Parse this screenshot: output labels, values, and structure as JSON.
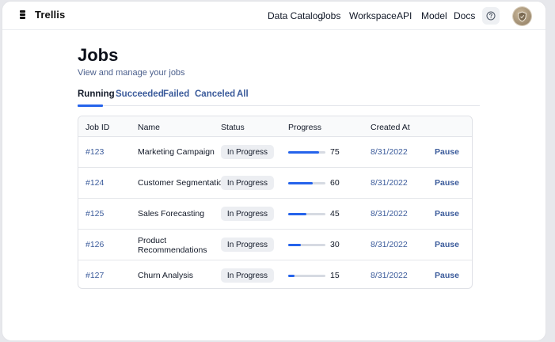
{
  "app": {
    "name": "Trellis"
  },
  "nav": [
    {
      "label": "Data Catalog"
    },
    {
      "label": "Jobs"
    },
    {
      "label": "Workspace"
    },
    {
      "label": "API"
    },
    {
      "label": "Model"
    },
    {
      "label": "Docs"
    }
  ],
  "header": {
    "help_icon": "help-circle-icon",
    "avatar_icon": "shield-icon"
  },
  "page": {
    "title": "Jobs",
    "subtitle": "View and manage your jobs"
  },
  "tabs": [
    {
      "label": "Running",
      "active": true
    },
    {
      "label": "Succeeded",
      "active": false
    },
    {
      "label": "Failed",
      "active": false
    },
    {
      "label": "Canceled",
      "active": false
    },
    {
      "label": "All",
      "active": false
    }
  ],
  "table": {
    "columns": [
      "Job ID",
      "Name",
      "Status",
      "Progress",
      "Created At"
    ],
    "rows": [
      {
        "id": "#123",
        "name": "Marketing Campaign",
        "status": "In Progress",
        "progress": 75,
        "created": "8/31/2022",
        "action": "Pause"
      },
      {
        "id": "#124",
        "name": "Customer Segmentation",
        "status": "In Progress",
        "progress": 60,
        "created": "8/31/2022",
        "action": "Pause"
      },
      {
        "id": "#125",
        "name": "Sales Forecasting",
        "status": "In Progress",
        "progress": 45,
        "created": "8/31/2022",
        "action": "Pause"
      },
      {
        "id": "#126",
        "name": "Product Recommendations",
        "status": "In Progress",
        "progress": 30,
        "created": "8/31/2022",
        "action": "Pause"
      },
      {
        "id": "#127",
        "name": "Churn Analysis",
        "status": "In Progress",
        "progress": 15,
        "created": "8/31/2022",
        "action": "Pause"
      }
    ]
  },
  "colors": {
    "accent": "#2563eb",
    "link": "#3b5b9b",
    "badge_bg": "#eceef2"
  }
}
